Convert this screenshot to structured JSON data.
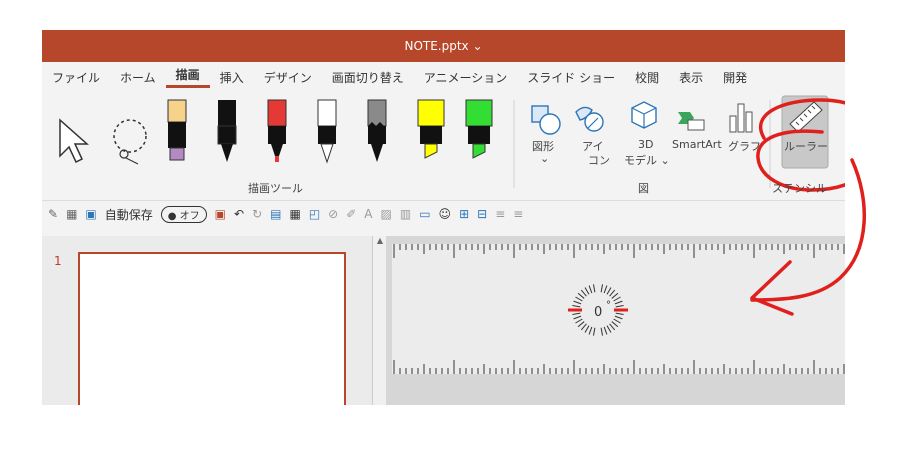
{
  "title_bar": {
    "title": "NOTE.pptx ⌄"
  },
  "tabs": [
    "ファイル",
    "ホーム",
    "描画",
    "挿入",
    "デザイン",
    "画面切り替え",
    "アニメーション",
    "スライド ショー",
    "校閲",
    "表示",
    "開発"
  ],
  "active_tab": "描画",
  "ribbon": {
    "draw_tools_label": "描画ツール",
    "figures_label": "図",
    "stencil_label": "ステンシル",
    "shape_label": "図形",
    "shape_sub": "⌄",
    "icon_label_line1": "アイ",
    "icon_label_line2": "コン",
    "model3d_line1": "3D",
    "model3d_line2": "モデル ⌄",
    "smartart_label": "SmartArt",
    "graph_label": "グラフ",
    "ruler_label": "ルーラー",
    "pens": [
      {
        "name": "highlighter-tan-pen",
        "color": "#f6d28a",
        "tip": "#b48ac2"
      },
      {
        "name": "black-pen",
        "color": "#111111",
        "tip": "#111111"
      },
      {
        "name": "red-pen",
        "color": "#e53935",
        "tip": "#111111"
      },
      {
        "name": "white-pen",
        "color": "#ffffff",
        "tip": "#111111"
      },
      {
        "name": "galaxy-pen",
        "color": "#8a8a8a",
        "tip": "#111111"
      },
      {
        "name": "yellow-highlighter",
        "color": "#ffff00",
        "tip": "#111111"
      },
      {
        "name": "green-highlighter",
        "color": "#33dd33",
        "tip": "#111111"
      }
    ]
  },
  "qat": {
    "autosave_label": "自動保存",
    "autosave_state": "オフ"
  },
  "slides": {
    "number": "1"
  },
  "ruler_tool": {
    "angle_text": "0",
    "degree_symbol": "°"
  },
  "colors": {
    "accent": "#b7472a",
    "annotation": "#e0201c"
  }
}
